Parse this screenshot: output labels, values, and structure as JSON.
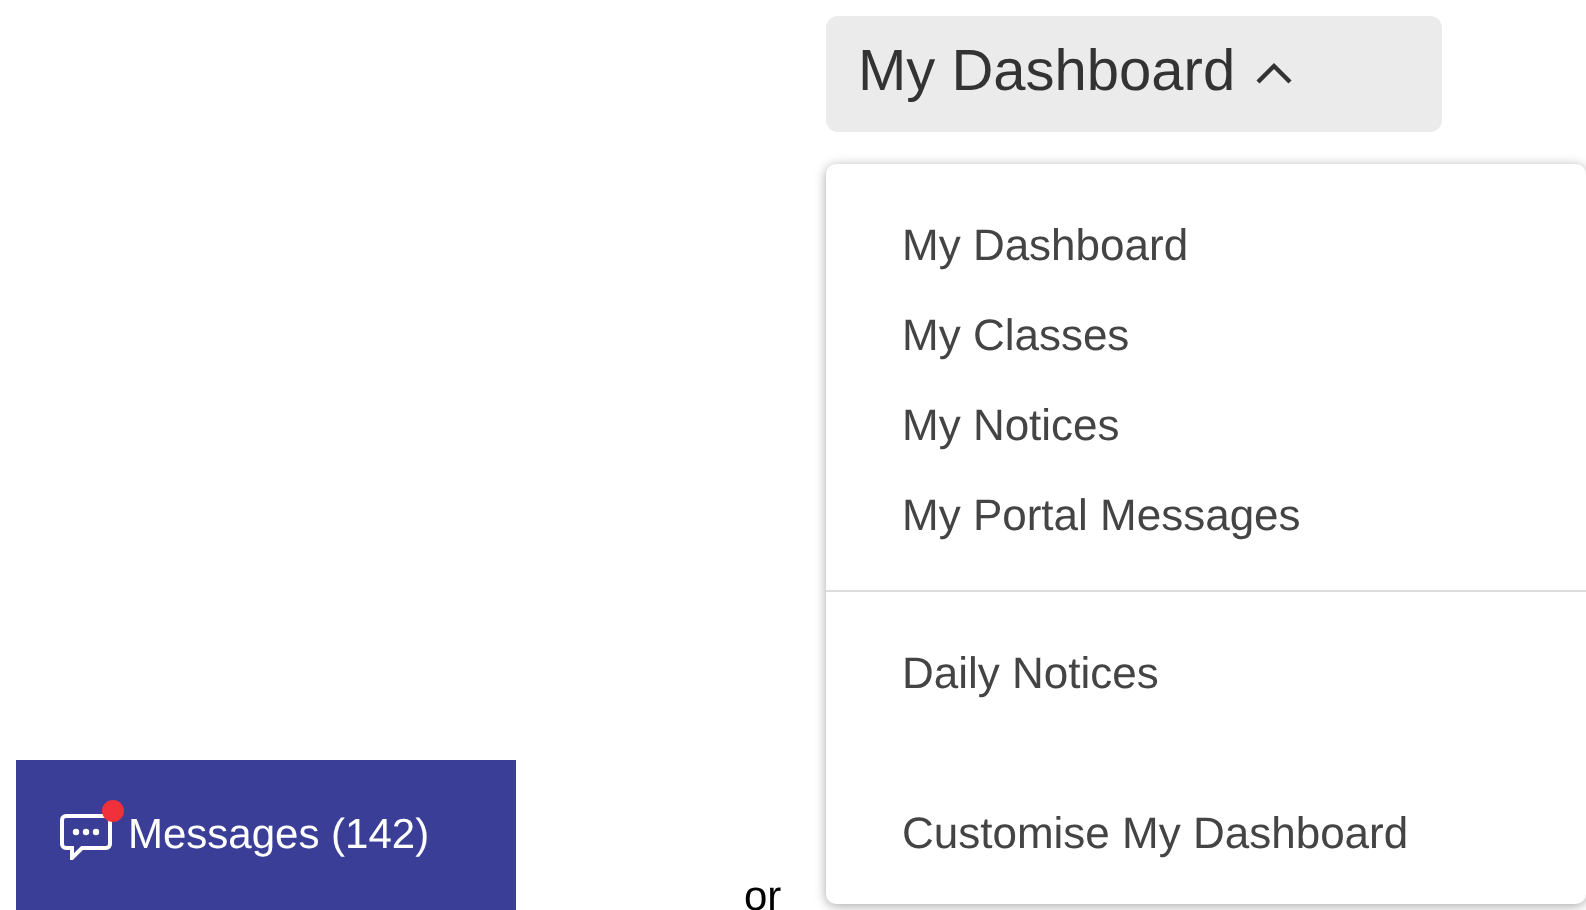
{
  "messages_button": {
    "label": "Messages (142)",
    "unread": true
  },
  "separator_text": "or",
  "dashboard_dropdown": {
    "label": "My Dashboard",
    "expanded": true,
    "items": [
      {
        "label": "My Dashboard",
        "divider_after": false
      },
      {
        "label": "My Classes",
        "divider_after": false
      },
      {
        "label": "My Notices",
        "divider_after": false
      },
      {
        "label": "My Portal Messages",
        "divider_after": true
      },
      {
        "label": "Daily Notices",
        "divider_after": false
      },
      {
        "label": "Customise My Dashboard",
        "divider_after": false
      }
    ]
  }
}
